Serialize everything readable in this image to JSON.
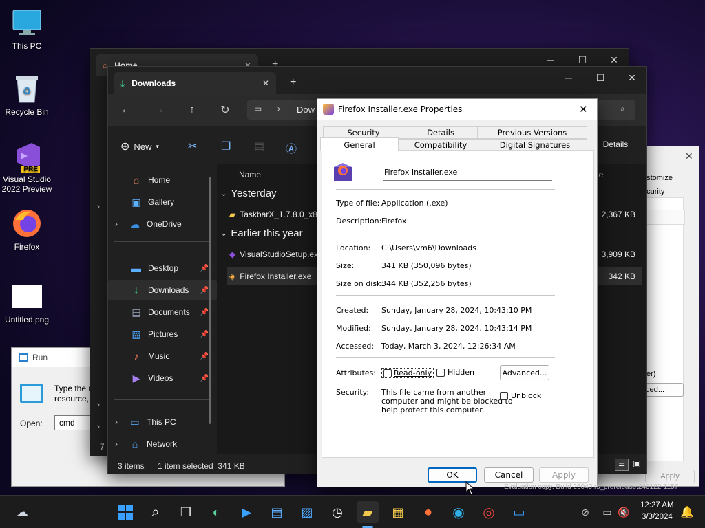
{
  "desktop": {
    "icons": [
      {
        "label": "This PC"
      },
      {
        "label": "Recycle Bin"
      },
      {
        "label": "Visual Studio 2022 Preview",
        "badge": "PRE"
      },
      {
        "label": "Firefox"
      },
      {
        "label": "Untitled.png"
      }
    ]
  },
  "bg_explorer": {
    "tab_label": "Home"
  },
  "explorer": {
    "tab_label": "Downloads",
    "address_partial": "Dow",
    "toolbar": {
      "new_label": "New",
      "details_label": "Details"
    },
    "sidebar": [
      {
        "label": "Home"
      },
      {
        "label": "Gallery"
      },
      {
        "label": "OneDrive"
      },
      {
        "label": "Desktop"
      },
      {
        "label": "Downloads"
      },
      {
        "label": "Documents"
      },
      {
        "label": "Pictures"
      },
      {
        "label": "Music"
      },
      {
        "label": "Videos"
      },
      {
        "label": "This PC"
      },
      {
        "label": "Network"
      }
    ],
    "column_name": "Name",
    "column_size_partial": "ize",
    "groups": [
      {
        "label": "Yesterday"
      },
      {
        "label": "Earlier this year"
      }
    ],
    "files": [
      {
        "name": "TaskbarX_1.7.8.0_x86",
        "size": "2,367 KB"
      },
      {
        "name": "VisualStudioSetup.ex",
        "size": "3,909 KB"
      },
      {
        "name": "Firefox Installer.exe",
        "size": "342 KB"
      }
    ],
    "status": {
      "items": "3 items",
      "selected": "1 item selected  341 KB"
    },
    "left_partial": "7 i"
  },
  "right_window": {
    "customize_partial": "ustomize",
    "security_partial": "ecurity",
    "er_partial": "er)",
    "nced_partial": "nced...",
    "cancel_partial": "Cancel",
    "apply": "Apply",
    "eval": "Evaluation copy. Build 26040.rs_prerelease.240122-1157"
  },
  "run_dialog": {
    "title": "Run",
    "text_line1": "Type the n",
    "text_line2": "resource, ",
    "open_label": "Open:",
    "input_value": "cmd"
  },
  "properties": {
    "title": "Firefox Installer.exe Properties",
    "tabs_row1": [
      "Security",
      "Details",
      "Previous Versions"
    ],
    "tabs_row2": [
      "General",
      "Compatibility",
      "Digital Signatures"
    ],
    "filename": "Firefox Installer.exe",
    "type_label": "Type of file:",
    "type_value": "Application (.exe)",
    "desc_label": "Description:",
    "desc_value": "Firefox",
    "location_label": "Location:",
    "location_value": "C:\\Users\\vm6\\Downloads",
    "size_label": "Size:",
    "size_value": "341 KB (350,096 bytes)",
    "disk_label": "Size on disk:",
    "disk_value": "344 KB (352,256 bytes)",
    "created_label": "Created:",
    "created_value": "Sunday, January 28, 2024, 10:43:10 PM",
    "modified_label": "Modified:",
    "modified_value": "Sunday, January 28, 2024, 10:43:14 PM",
    "accessed_label": "Accessed:",
    "accessed_value": "Today, March 3, 2024, 12:26:34 AM",
    "attributes_label": "Attributes:",
    "readonly_label": "Read-only",
    "hidden_label": "Hidden",
    "advanced_label": "Advanced...",
    "security_label": "Security:",
    "security_text": [
      "This file came from another",
      "computer and might be blocked to",
      "help protect this computer."
    ],
    "unblock_label": "Unblock",
    "ok_label": "OK",
    "cancel_label": "Cancel",
    "apply_label": "Apply"
  },
  "taskbar": {
    "time": "12:27 AM",
    "date": "3/3/2024"
  },
  "colors": {
    "accent": "#0067c0",
    "explorer_bg": "#202020",
    "dialog_bg": "#f0f0f0"
  }
}
